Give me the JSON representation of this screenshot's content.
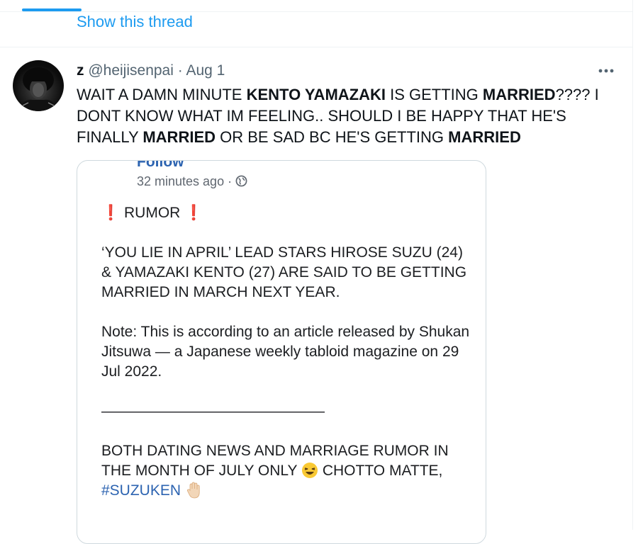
{
  "thread": {
    "show_thread_label": "Show this thread"
  },
  "tweet": {
    "display_name": "z",
    "handle": "@heijisenpai",
    "separator": "·",
    "date": "Aug 1",
    "text_parts": [
      "WAIT A DAMN MINUTE ",
      "KENTO YAMAZAKI",
      " IS GETTING ",
      "MARRIED",
      "???? I DONT KNOW WHAT IM FEELING.. SHOULD I BE HAPPY THAT HE'S FINALLY ",
      "MARRIED",
      " OR BE SAD BC HE'S GETTING ",
      "MARRIED"
    ],
    "more_icon": "ellipsis-icon",
    "avatar_icon": "avatar"
  },
  "card": {
    "follow_label": "Follow",
    "time_ago": "32 minutes ago",
    "time_separator": "·",
    "privacy_icon": "globe-icon",
    "rumor_label": "RUMOR",
    "headline": "‘YOU LIE IN APRIL’ LEAD STARS HIROSE SUZU (24) & YAMAZAKI KENTO (27) ARE SAID TO BE GETTING MARRIED IN MARCH NEXT YEAR.",
    "note": "Note: This is according to an article released by Shukan Jitsuwa — a Japanese weekly tabloid magazine on 29 Jul 2022.",
    "divider": "———————————————",
    "footer_text_1": "BOTH DATING NEWS AND MARRIAGE RUMOR IN THE MONTH OF JULY ONLY",
    "footer_text_2": "CHOTTO MATTE,",
    "hashtag": "#SUZUKEN",
    "emoji_laugh": "laughing-face-emoji",
    "emoji_hand": "raised-hand-emoji"
  },
  "colors": {
    "link": "#1d9bf0",
    "card_link": "#2d64b1",
    "text": "#0f1419",
    "muted": "#536471",
    "rumor_mark": "#d93025"
  }
}
